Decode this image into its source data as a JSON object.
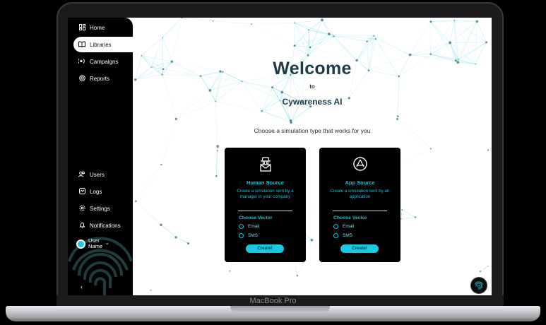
{
  "device": {
    "label": "MacBook Pro"
  },
  "sidebar": {
    "top_items": [
      {
        "label": "Home",
        "icon": "dashboard-icon"
      },
      {
        "label": "Libraries",
        "icon": "book-icon",
        "active": true
      },
      {
        "label": "Campaigns",
        "icon": "campaign-icon"
      },
      {
        "label": "Reports",
        "icon": "report-icon"
      }
    ],
    "bottom_items": [
      {
        "label": "Users",
        "icon": "users-icon"
      },
      {
        "label": "Logs",
        "icon": "logs-icon"
      },
      {
        "label": "Settings",
        "icon": "gear-icon"
      },
      {
        "label": "Notifications",
        "icon": "bell-icon"
      }
    ],
    "user": {
      "line1": "User",
      "line2": "Name"
    }
  },
  "hero": {
    "title": "Welcome",
    "to": "to",
    "subtitle": "Cywareness AI"
  },
  "prompt": "Choose a simulation type that works for you",
  "cards": [
    {
      "title": "Human Source",
      "description": "Create a simulation sent by a manager in your company",
      "vector_label": "Choose Vector",
      "options": [
        "Email",
        "SMS"
      ],
      "button": "Create!"
    },
    {
      "title": "App Source",
      "description": "Create a simulation sent by an application",
      "vector_label": "Choose Vector",
      "options": [
        "Email",
        "SMS"
      ],
      "button": "Create!"
    }
  ],
  "colors": {
    "accent": "#17c3db",
    "heading": "#1d3a4a",
    "sidebar": "#000000"
  }
}
